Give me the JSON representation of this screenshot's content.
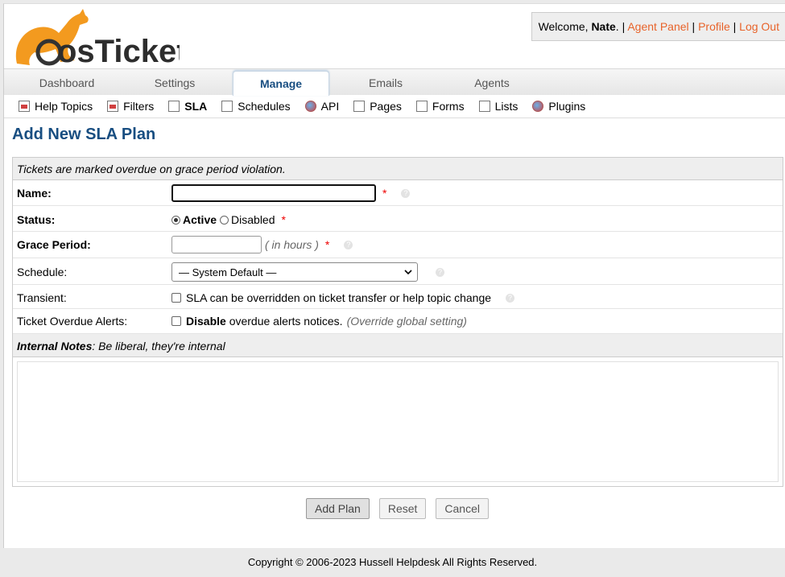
{
  "header": {
    "logo_text": "osTicket",
    "welcome_prefix": "Welcome, ",
    "user_name": "Nate",
    "welcome_suffix": ".",
    "separator": "|",
    "links": {
      "agent_panel": "Agent Panel",
      "profile": "Profile",
      "logout": "Log Out"
    }
  },
  "tabs": [
    "Dashboard",
    "Settings",
    "Manage",
    "Emails",
    "Agents"
  ],
  "active_tab": "Manage",
  "subnav": [
    "Help Topics",
    "Filters",
    "SLA",
    "Schedules",
    "API",
    "Pages",
    "Forms",
    "Lists",
    "Plugins"
  ],
  "active_subnav": "SLA",
  "page_title": "Add New SLA Plan",
  "form": {
    "intro": "Tickets are marked overdue on grace period violation.",
    "name": {
      "label": "Name:",
      "value": ""
    },
    "status": {
      "label": "Status:",
      "options": [
        "Active",
        "Disabled"
      ],
      "selected": "Active"
    },
    "grace": {
      "label": "Grace Period:",
      "value": "",
      "hint": "( in hours )"
    },
    "schedule": {
      "label": "Schedule:",
      "value": "— System Default —"
    },
    "transient": {
      "label": "Transient:",
      "text": "SLA can be overridden on ticket transfer or help topic change",
      "checked": false
    },
    "alerts": {
      "label": "Ticket Overdue Alerts:",
      "bold": "Disable",
      "text": " overdue alerts notices.",
      "note": "(Override global setting)",
      "checked": false
    },
    "required_mark": "*",
    "help_mark": "?",
    "notes": {
      "title": "Internal Notes",
      "subtitle": ": Be liberal, they're internal",
      "value": ""
    }
  },
  "buttons": {
    "add": "Add Plan",
    "reset": "Reset",
    "cancel": "Cancel"
  },
  "footer": "Copyright © 2006-2023 Hussell Helpdesk All Rights Reserved.",
  "colors": {
    "brand_orange": "#e8632a",
    "title_blue": "#184e81"
  }
}
